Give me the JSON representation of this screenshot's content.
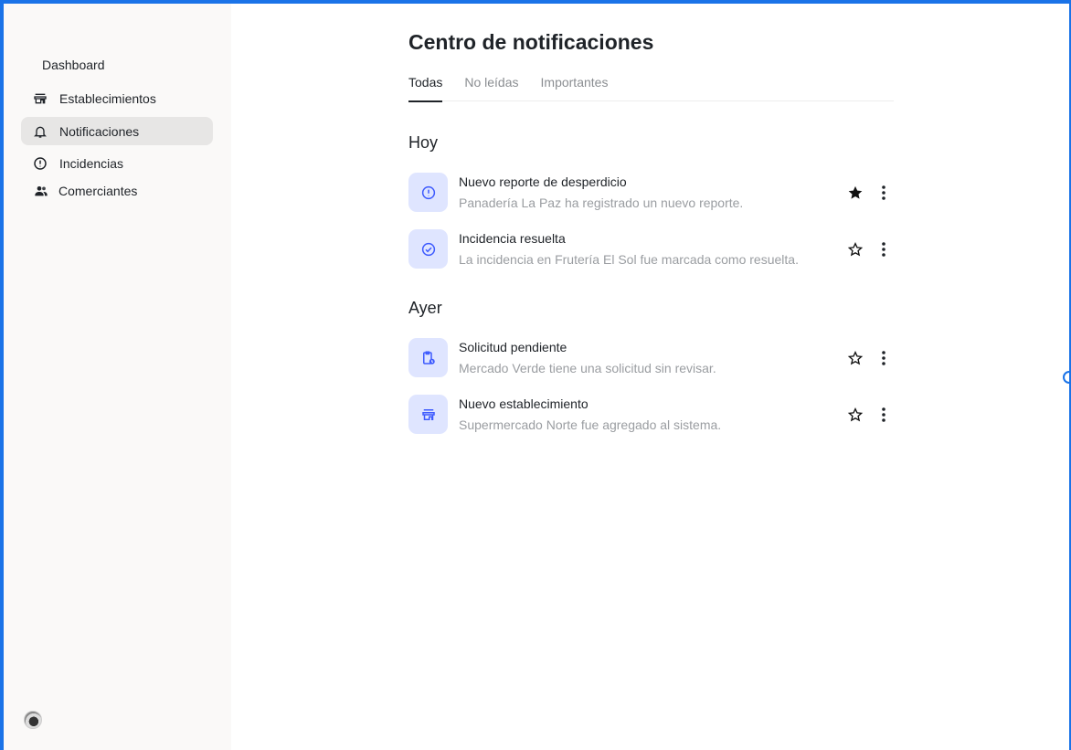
{
  "sidebar": {
    "dashboard_label": "Dashboard",
    "items": [
      {
        "label": "Establecimientos",
        "icon": "store-icon",
        "active": false
      },
      {
        "label": "Notificaciones",
        "icon": "bell-icon",
        "active": true
      },
      {
        "label": "Incidencias",
        "icon": "alert-circle-icon",
        "active": false
      },
      {
        "label": "Comerciantes",
        "icon": "people-icon",
        "active": false
      }
    ]
  },
  "main": {
    "title": "Centro de notificaciones",
    "tabs": [
      {
        "label": "Todas",
        "active": true
      },
      {
        "label": "No leídas",
        "active": false
      },
      {
        "label": "Importantes",
        "active": false
      }
    ],
    "groups": [
      {
        "title": "Hoy",
        "items": [
          {
            "title": "Nuevo reporte de desperdicio",
            "description": "Panadería La Paz ha registrado un nuevo reporte.",
            "icon": "alert-circle-icon",
            "starred": true
          },
          {
            "title": "Incidencia resuelta",
            "description": "La incidencia en Frutería El Sol fue marcada como resuelta.",
            "icon": "check-circle-icon",
            "starred": false
          }
        ]
      },
      {
        "title": "Ayer",
        "items": [
          {
            "title": "Solicitud pendiente",
            "description": "Mercado Verde tiene una solicitud sin revisar.",
            "icon": "clipboard-clock-icon",
            "starred": false
          },
          {
            "title": "Nuevo establecimiento",
            "description": "Supermercado Norte fue agregado al sistema.",
            "icon": "store-icon",
            "starred": false
          }
        ]
      }
    ]
  },
  "colors": {
    "accent": "#3d5afe",
    "badge_bg": "#dfe5ff",
    "sidebar_bg": "#faf9f8",
    "active_nav_bg": "#e7e6e5",
    "window_border": "#1a73e8"
  }
}
